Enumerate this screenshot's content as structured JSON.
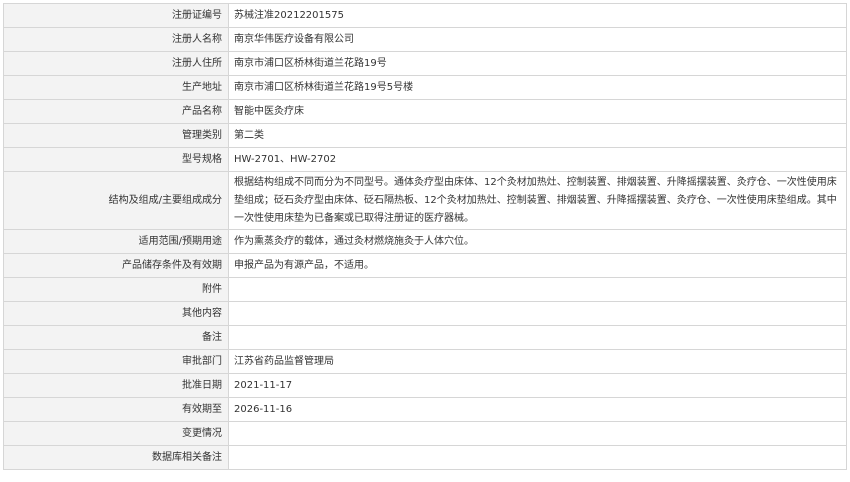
{
  "rows": [
    {
      "label": "注册证编号",
      "value": "苏械注准20212201575"
    },
    {
      "label": "注册人名称",
      "value": "南京华伟医疗设备有限公司"
    },
    {
      "label": "注册人住所",
      "value": "南京市浦口区桥林街道兰花路19号"
    },
    {
      "label": "生产地址",
      "value": "南京市浦口区桥林街道兰花路19号5号楼"
    },
    {
      "label": "产品名称",
      "value": "智能中医灸疗床"
    },
    {
      "label": "管理类别",
      "value": "第二类"
    },
    {
      "label": "型号规格",
      "value": "HW-2701、HW-2702"
    },
    {
      "label": "结构及组成/主要组成成分",
      "value": "根据结构组成不同而分为不同型号。通体灸疗型由床体、12个灸材加热灶、控制装置、排烟装置、升降摇摆装置、灸疗仓、一次性使用床垫组成；砭石灸疗型由床体、砭石隔热板、12个灸材加热灶、控制装置、排烟装置、升降摇摆装置、灸疗仓、一次性使用床垫组成。其中一次性使用床垫为已备案或已取得注册证的医疗器械。"
    },
    {
      "label": "适用范围/预期用途",
      "value": "作为熏蒸灸疗的载体，通过灸材燃烧施灸于人体穴位。"
    },
    {
      "label": "产品储存条件及有效期",
      "value": "申报产品为有源产品，不适用。"
    },
    {
      "label": "附件",
      "value": ""
    },
    {
      "label": "其他内容",
      "value": ""
    },
    {
      "label": "备注",
      "value": ""
    },
    {
      "label": "审批部门",
      "value": "江苏省药品监督管理局"
    },
    {
      "label": "批准日期",
      "value": "2021-11-17"
    },
    {
      "label": "有效期至",
      "value": "2026-11-16"
    },
    {
      "label": "变更情况",
      "value": ""
    },
    {
      "label": "数据库相关备注",
      "value": ""
    }
  ]
}
